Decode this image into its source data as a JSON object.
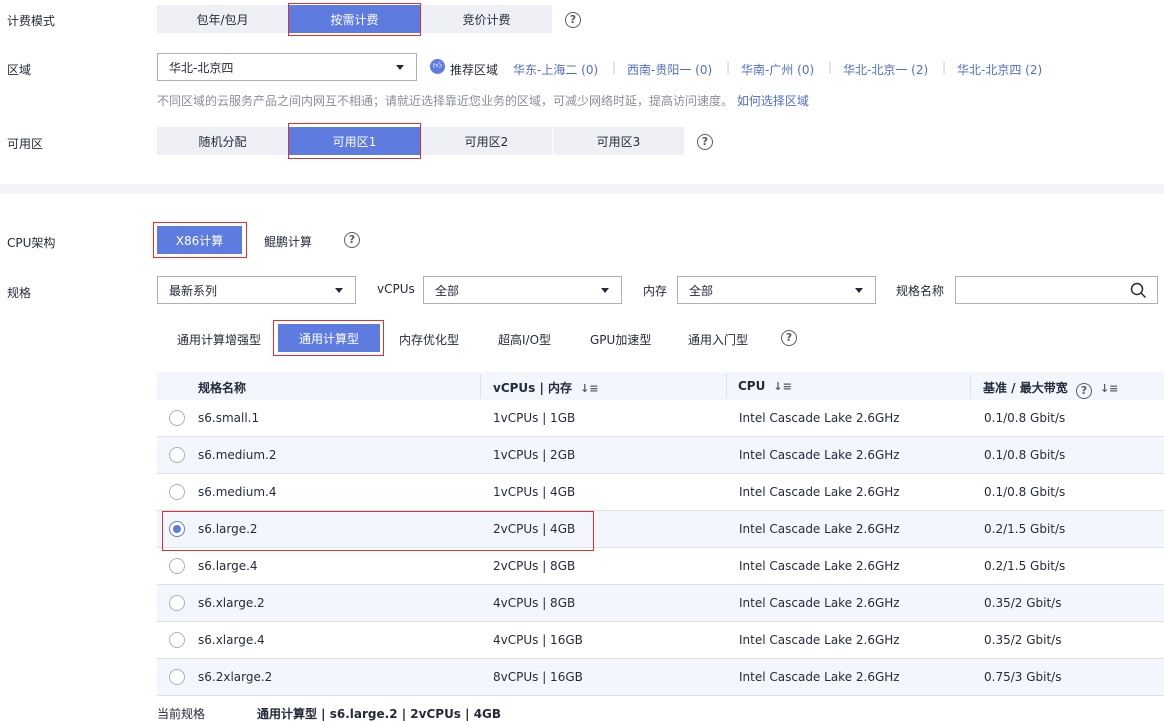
{
  "billing": {
    "label": "计费模式",
    "options": [
      "包年/包月",
      "按需计费",
      "竞价计费"
    ],
    "selected": "按需计费"
  },
  "region": {
    "label": "区域",
    "value": "华北-北京四",
    "recommend_label": "推荐区域",
    "recommended": [
      "华东-上海二 (0)",
      "西南-贵阳一 (0)",
      "华南-广州 (0)",
      "华北-北京一 (2)",
      "华北-北京四 (2)"
    ],
    "hint": "不同区域的云服务产品之间内网互不相通；请就近选择靠近您业务的区域，可减少网络时延，提高访问速度。",
    "hint_link": "如何选择区域"
  },
  "az": {
    "label": "可用区",
    "options": [
      "随机分配",
      "可用区1",
      "可用区2",
      "可用区3"
    ],
    "selected": "可用区1"
  },
  "cpu_arch": {
    "label": "CPU架构",
    "options": [
      "X86计算",
      "鲲鹏计算"
    ],
    "selected": "X86计算"
  },
  "spec_filter": {
    "label": "规格",
    "series": "最新系列",
    "vcpus_label": "vCPUs",
    "vcpus_value": "全部",
    "mem_label": "内存",
    "mem_value": "全部",
    "name_label": "规格名称",
    "name_placeholder": ""
  },
  "spec_types": {
    "options": [
      "通用计算增强型",
      "通用计算型",
      "内存优化型",
      "超高I/O型",
      "GPU加速型",
      "通用入门型"
    ],
    "selected": "通用计算型"
  },
  "table": {
    "headers": [
      "规格名称",
      "vCPUs | 内存",
      "CPU",
      "基准 / 最大带宽"
    ],
    "rows": [
      {
        "name": "s6.small.1",
        "vcpu_mem": "1vCPUs | 1GB",
        "cpu": "Intel Cascade Lake 2.6GHz",
        "bw": "0.1/0.8 Gbit/s",
        "selected": false
      },
      {
        "name": "s6.medium.2",
        "vcpu_mem": "1vCPUs | 2GB",
        "cpu": "Intel Cascade Lake 2.6GHz",
        "bw": "0.1/0.8 Gbit/s",
        "selected": false
      },
      {
        "name": "s6.medium.4",
        "vcpu_mem": "1vCPUs | 4GB",
        "cpu": "Intel Cascade Lake 2.6GHz",
        "bw": "0.1/0.8 Gbit/s",
        "selected": false
      },
      {
        "name": "s6.large.2",
        "vcpu_mem": "2vCPUs | 4GB",
        "cpu": "Intel Cascade Lake 2.6GHz",
        "bw": "0.2/1.5 Gbit/s",
        "selected": true
      },
      {
        "name": "s6.large.4",
        "vcpu_mem": "2vCPUs | 8GB",
        "cpu": "Intel Cascade Lake 2.6GHz",
        "bw": "0.2/1.5 Gbit/s",
        "selected": false
      },
      {
        "name": "s6.xlarge.2",
        "vcpu_mem": "4vCPUs | 8GB",
        "cpu": "Intel Cascade Lake 2.6GHz",
        "bw": "0.35/2 Gbit/s",
        "selected": false
      },
      {
        "name": "s6.xlarge.4",
        "vcpu_mem": "4vCPUs | 16GB",
        "cpu": "Intel Cascade Lake 2.6GHz",
        "bw": "0.35/2 Gbit/s",
        "selected": false
      },
      {
        "name": "s6.2xlarge.2",
        "vcpu_mem": "8vCPUs | 16GB",
        "cpu": "Intel Cascade Lake 2.6GHz",
        "bw": "0.75/3 Gbit/s",
        "selected": false
      }
    ]
  },
  "current_spec": {
    "label": "当前规格",
    "value": "通用计算型 | s6.large.2 | 2vCPUs | 4GB"
  },
  "colors": {
    "accent": "#5e7ce0",
    "highlight_border": "#e2302f",
    "link": "#526ecc"
  }
}
